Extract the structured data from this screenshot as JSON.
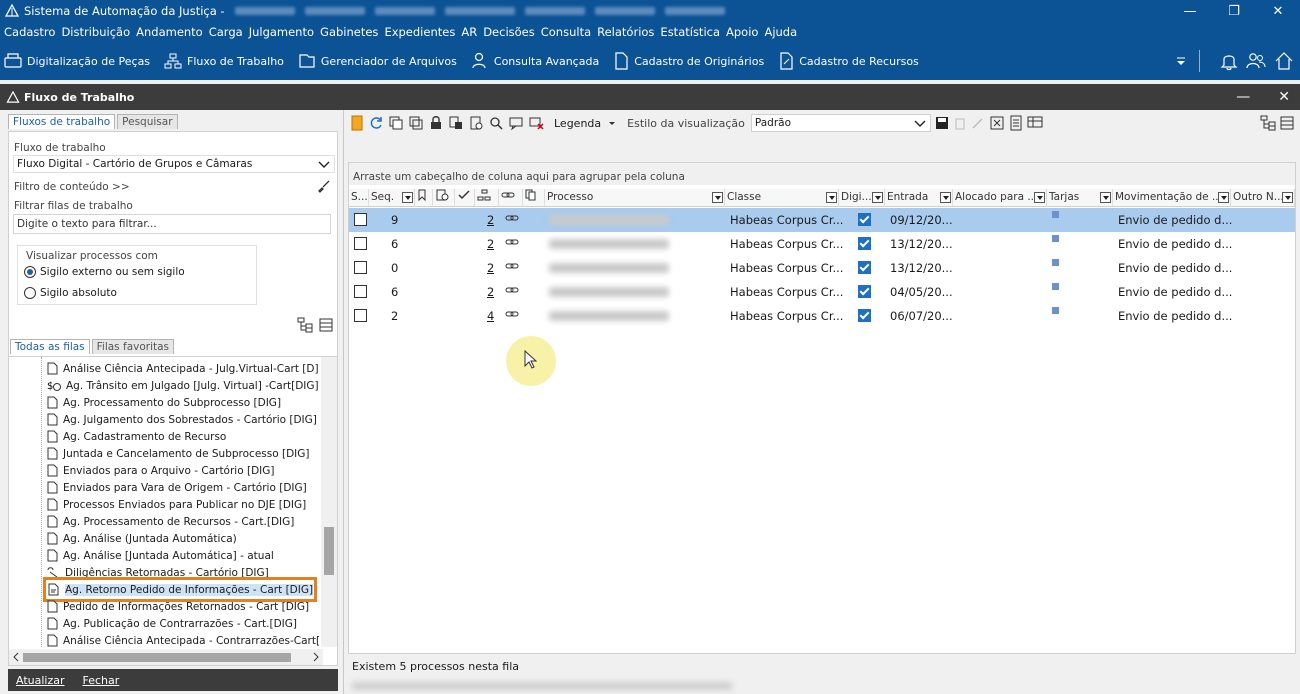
{
  "window": {
    "title": "Sistema de Automação da Justiça -"
  },
  "menu": [
    "Cadastro",
    "Distribuição",
    "Andamento",
    "Carga",
    "Julgamento",
    "Gabinetes",
    "Expedientes",
    "AR",
    "Decisões",
    "Consulta",
    "Relatórios",
    "Estatística",
    "Apoio",
    "Ajuda"
  ],
  "toolbar": [
    "Digitalização de Peças",
    "Fluxo de Trabalho",
    "Gerenciador de Arquivos",
    "Consulta Avançada",
    "Cadastro de Originários",
    "Cadastro de Recursos"
  ],
  "subwindow": {
    "title": "Fluxo de Trabalho"
  },
  "left": {
    "tabs": [
      "Fluxos de trabalho",
      "Pesquisar"
    ],
    "workflow_label": "Fluxo de trabalho",
    "workflow_value": "Fluxo Digital - Cartório de Grupos e Câmaras",
    "content_filter": "Filtro de conteúdo >>",
    "queue_filter_label": "Filtrar filas de trabalho",
    "queue_filter_placeholder": "Digite o texto para filtrar...",
    "view_group_label": "Visualizar processos com",
    "radio_external": "Sigilo externo ou sem sigilo",
    "radio_absolute": "Sigilo absoluto",
    "queue_tabs": [
      "Todas as filas",
      "Filas favoritas"
    ],
    "queues": [
      "Análise Ciência Antecipada - Julg.Virtual-Cart [D]",
      "Ag. Trânsito em Julgado [Julg. Virtual] -Cart[DIG]",
      "Ag. Processamento do Subprocesso [DIG]",
      "Ag. Julgamento dos Sobrestados - Cartório [DIG]",
      "Ag. Cadastramento de Recurso",
      "Juntada e Cancelamento de Subprocesso [DIG]",
      "Enviados para o Arquivo - Cartório [DIG]",
      "Enviados para Vara de Origem - Cartório [DIG]",
      "Processos Enviados para Publicar no DJE [DIG]",
      "Ag. Processamento de Recursos - Cart.[DIG]",
      "Ag. Análise (Juntada Automática)",
      "Ag. Análise [Juntada Automática] - atual",
      "Diligências Retornadas - Cartório [DIG]",
      "Ag. Retorno Pedido de Informações - Cart [DIG]",
      "Pedido de Informações Retornados - Cart [DIG]",
      "Ag. Publicação de Contrarrazões - Cart.[DIG]",
      "Análise Ciência Antecipada - Contrarrazões-Cart[D]"
    ],
    "footer_update": "Atualizar",
    "footer_close": "Fechar"
  },
  "right": {
    "legend": "Legenda",
    "view_style_label": "Estilo da visualização",
    "view_style_value": "Padrão",
    "group_hint": "Arraste um cabeçalho de coluna aqui para agrupar pela coluna",
    "columns": [
      "S...",
      "Seq.",
      "Processo",
      "Classe",
      "Digi...",
      "Entrada",
      "Alocado para ...",
      "Tarjas",
      "Movimentação de ...",
      "Outro N..."
    ],
    "rows": [
      {
        "seq": "9",
        "n": "2",
        "classe": "Habeas Corpus Cr...",
        "entrada": "09/12/20...",
        "mov": "Envio de pedido d..."
      },
      {
        "seq": "6",
        "n": "2",
        "classe": "Habeas Corpus Cr...",
        "entrada": "13/12/20...",
        "mov": "Envio de pedido d..."
      },
      {
        "seq": "0",
        "n": "2",
        "classe": "Habeas Corpus Cr...",
        "entrada": "13/12/20...",
        "mov": "Envio de pedido d..."
      },
      {
        "seq": "6",
        "n": "2",
        "classe": "Habeas Corpus Cr...",
        "entrada": "04/05/20...",
        "mov": "Envio de pedido d..."
      },
      {
        "seq": "2",
        "n": "4",
        "classe": "Habeas Corpus Cr...",
        "entrada": "06/07/20...",
        "mov": "Envio de pedido d..."
      }
    ],
    "status": "Existem 5 processos nesta fila"
  }
}
